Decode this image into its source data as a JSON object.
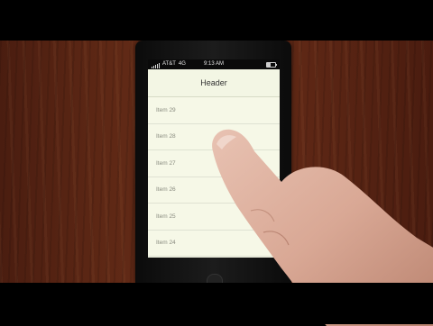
{
  "status_bar": {
    "carrier": "AT&T",
    "network": "4G",
    "time": "9:13 AM",
    "signal_bars": 5,
    "battery_level": 0.45
  },
  "nav": {
    "title": "Header"
  },
  "list": {
    "items": [
      {
        "label": "Item 29"
      },
      {
        "label": "Item 28"
      },
      {
        "label": "Item 27"
      },
      {
        "label": "Item 26"
      },
      {
        "label": "Item 25"
      },
      {
        "label": "Item 24"
      }
    ]
  },
  "colors": {
    "screen_background": "#f6f8e7",
    "item_text": "#8a8c80",
    "wood": "#5e2815"
  }
}
